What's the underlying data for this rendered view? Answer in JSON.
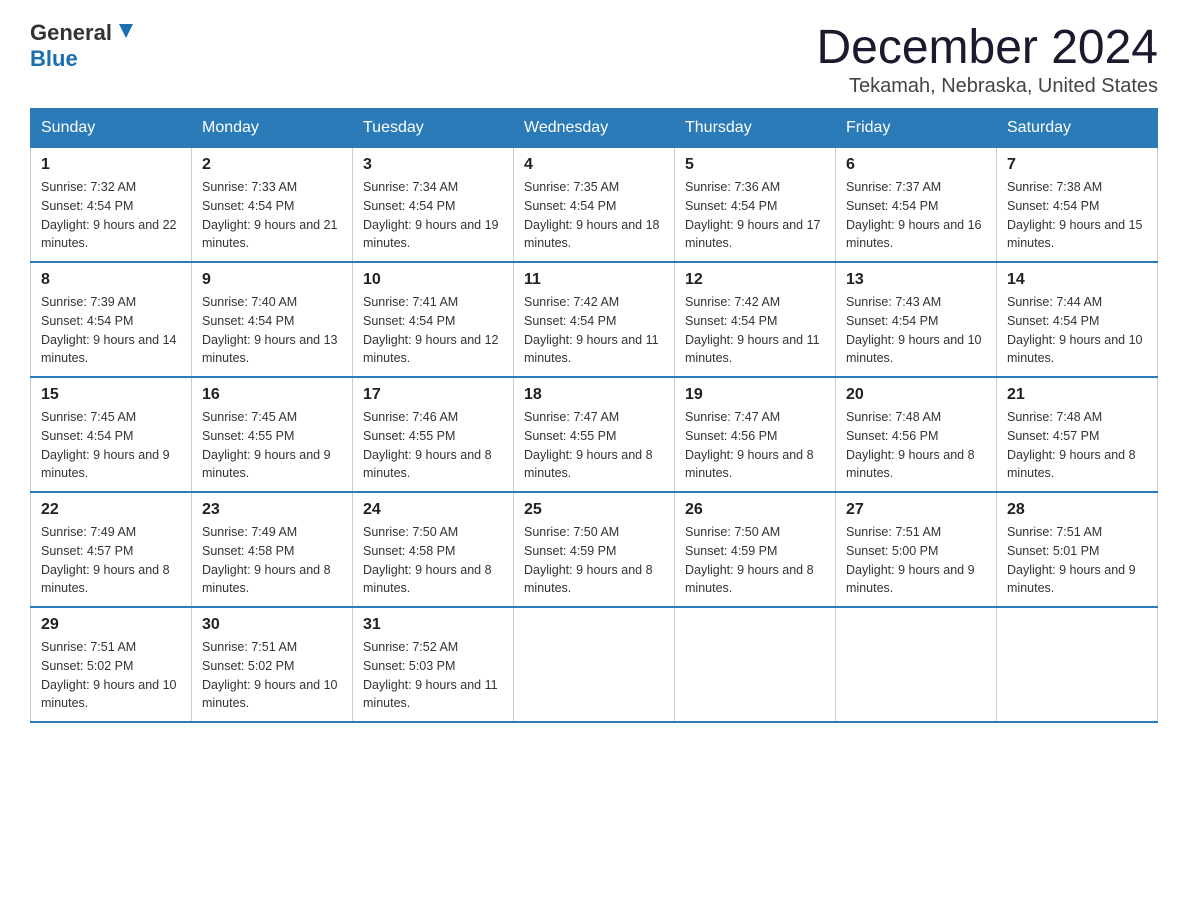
{
  "header": {
    "logo_general": "General",
    "logo_blue": "Blue",
    "month_title": "December 2024",
    "location": "Tekamah, Nebraska, United States"
  },
  "weekdays": [
    "Sunday",
    "Monday",
    "Tuesday",
    "Wednesday",
    "Thursday",
    "Friday",
    "Saturday"
  ],
  "weeks": [
    [
      {
        "day": "1",
        "sunrise": "7:32 AM",
        "sunset": "4:54 PM",
        "daylight": "9 hours and 22 minutes."
      },
      {
        "day": "2",
        "sunrise": "7:33 AM",
        "sunset": "4:54 PM",
        "daylight": "9 hours and 21 minutes."
      },
      {
        "day": "3",
        "sunrise": "7:34 AM",
        "sunset": "4:54 PM",
        "daylight": "9 hours and 19 minutes."
      },
      {
        "day": "4",
        "sunrise": "7:35 AM",
        "sunset": "4:54 PM",
        "daylight": "9 hours and 18 minutes."
      },
      {
        "day": "5",
        "sunrise": "7:36 AM",
        "sunset": "4:54 PM",
        "daylight": "9 hours and 17 minutes."
      },
      {
        "day": "6",
        "sunrise": "7:37 AM",
        "sunset": "4:54 PM",
        "daylight": "9 hours and 16 minutes."
      },
      {
        "day": "7",
        "sunrise": "7:38 AM",
        "sunset": "4:54 PM",
        "daylight": "9 hours and 15 minutes."
      }
    ],
    [
      {
        "day": "8",
        "sunrise": "7:39 AM",
        "sunset": "4:54 PM",
        "daylight": "9 hours and 14 minutes."
      },
      {
        "day": "9",
        "sunrise": "7:40 AM",
        "sunset": "4:54 PM",
        "daylight": "9 hours and 13 minutes."
      },
      {
        "day": "10",
        "sunrise": "7:41 AM",
        "sunset": "4:54 PM",
        "daylight": "9 hours and 12 minutes."
      },
      {
        "day": "11",
        "sunrise": "7:42 AM",
        "sunset": "4:54 PM",
        "daylight": "9 hours and 11 minutes."
      },
      {
        "day": "12",
        "sunrise": "7:42 AM",
        "sunset": "4:54 PM",
        "daylight": "9 hours and 11 minutes."
      },
      {
        "day": "13",
        "sunrise": "7:43 AM",
        "sunset": "4:54 PM",
        "daylight": "9 hours and 10 minutes."
      },
      {
        "day": "14",
        "sunrise": "7:44 AM",
        "sunset": "4:54 PM",
        "daylight": "9 hours and 10 minutes."
      }
    ],
    [
      {
        "day": "15",
        "sunrise": "7:45 AM",
        "sunset": "4:54 PM",
        "daylight": "9 hours and 9 minutes."
      },
      {
        "day": "16",
        "sunrise": "7:45 AM",
        "sunset": "4:55 PM",
        "daylight": "9 hours and 9 minutes."
      },
      {
        "day": "17",
        "sunrise": "7:46 AM",
        "sunset": "4:55 PM",
        "daylight": "9 hours and 8 minutes."
      },
      {
        "day": "18",
        "sunrise": "7:47 AM",
        "sunset": "4:55 PM",
        "daylight": "9 hours and 8 minutes."
      },
      {
        "day": "19",
        "sunrise": "7:47 AM",
        "sunset": "4:56 PM",
        "daylight": "9 hours and 8 minutes."
      },
      {
        "day": "20",
        "sunrise": "7:48 AM",
        "sunset": "4:56 PM",
        "daylight": "9 hours and 8 minutes."
      },
      {
        "day": "21",
        "sunrise": "7:48 AM",
        "sunset": "4:57 PM",
        "daylight": "9 hours and 8 minutes."
      }
    ],
    [
      {
        "day": "22",
        "sunrise": "7:49 AM",
        "sunset": "4:57 PM",
        "daylight": "9 hours and 8 minutes."
      },
      {
        "day": "23",
        "sunrise": "7:49 AM",
        "sunset": "4:58 PM",
        "daylight": "9 hours and 8 minutes."
      },
      {
        "day": "24",
        "sunrise": "7:50 AM",
        "sunset": "4:58 PM",
        "daylight": "9 hours and 8 minutes."
      },
      {
        "day": "25",
        "sunrise": "7:50 AM",
        "sunset": "4:59 PM",
        "daylight": "9 hours and 8 minutes."
      },
      {
        "day": "26",
        "sunrise": "7:50 AM",
        "sunset": "4:59 PM",
        "daylight": "9 hours and 8 minutes."
      },
      {
        "day": "27",
        "sunrise": "7:51 AM",
        "sunset": "5:00 PM",
        "daylight": "9 hours and 9 minutes."
      },
      {
        "day": "28",
        "sunrise": "7:51 AM",
        "sunset": "5:01 PM",
        "daylight": "9 hours and 9 minutes."
      }
    ],
    [
      {
        "day": "29",
        "sunrise": "7:51 AM",
        "sunset": "5:02 PM",
        "daylight": "9 hours and 10 minutes."
      },
      {
        "day": "30",
        "sunrise": "7:51 AM",
        "sunset": "5:02 PM",
        "daylight": "9 hours and 10 minutes."
      },
      {
        "day": "31",
        "sunrise": "7:52 AM",
        "sunset": "5:03 PM",
        "daylight": "9 hours and 11 minutes."
      },
      null,
      null,
      null,
      null
    ]
  ]
}
